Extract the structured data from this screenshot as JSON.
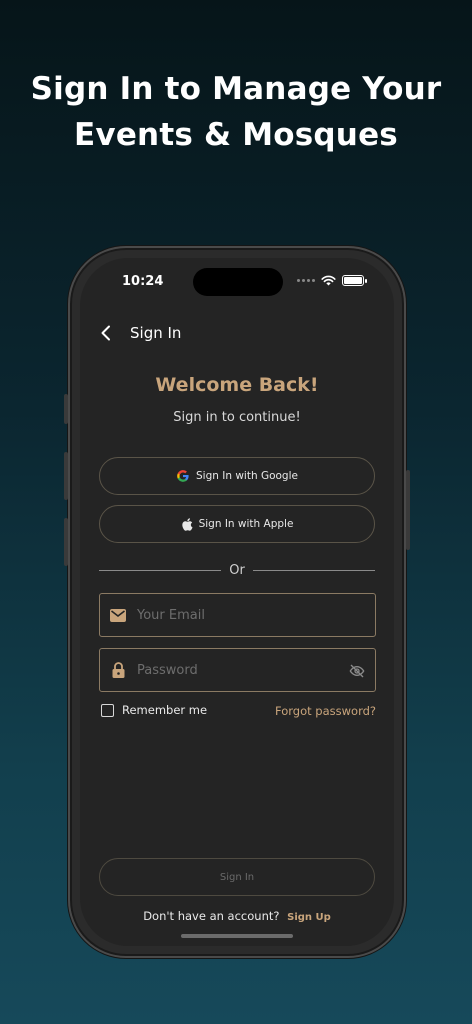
{
  "headline": {
    "line1": "Sign In to Manage Your",
    "line2": "Events & Mosques"
  },
  "status_bar": {
    "time": "10:24"
  },
  "navbar": {
    "title": "Sign In"
  },
  "welcome": {
    "title": "Welcome Back!",
    "subtitle": "Sign in to continue!"
  },
  "oauth": {
    "google_label": "Sign In with Google",
    "apple_label": "Sign In with Apple"
  },
  "divider": {
    "label": "Or"
  },
  "email": {
    "placeholder": "Your Email",
    "value": ""
  },
  "password": {
    "placeholder": "Password",
    "value": ""
  },
  "remember_me": {
    "label": "Remember me",
    "checked": false
  },
  "forgot_password": {
    "label": "Forgot password?"
  },
  "submit": {
    "label": "Sign In"
  },
  "signup": {
    "prompt": "Don't have an account?",
    "link": "Sign Up"
  },
  "colors": {
    "accent": "#c9a57c",
    "background_top": "#061519",
    "background_bottom": "#16495a",
    "screen": "#242424"
  },
  "icons": [
    "chevron-left-icon",
    "google-icon",
    "apple-icon",
    "mail-icon",
    "lock-icon",
    "eye-off-icon",
    "wifi-icon",
    "battery-icon"
  ]
}
